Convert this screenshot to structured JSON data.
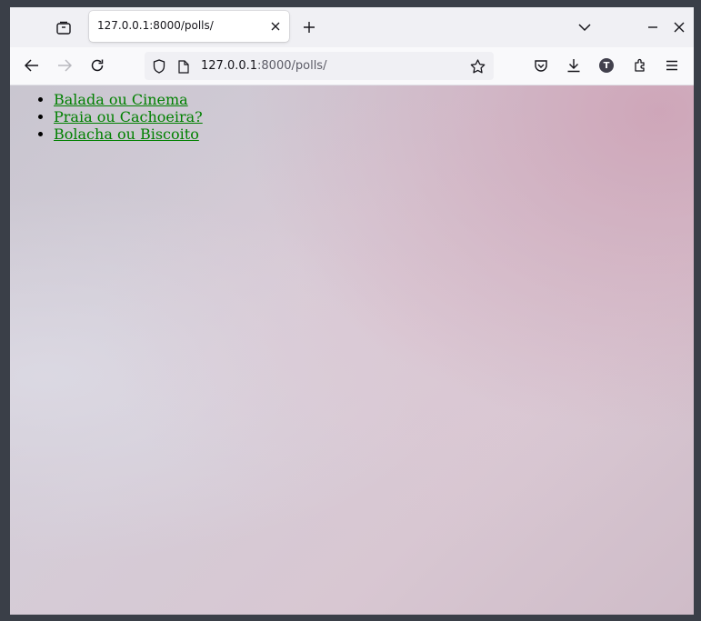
{
  "browser": {
    "tab": {
      "title": "127.0.0.1:8000/polls/"
    },
    "url": {
      "host": "127.0.0.1",
      "rest": ":8000/polls/"
    },
    "account_initial": "T"
  },
  "page": {
    "polls": [
      {
        "label": "Balada ou Cinema"
      },
      {
        "label": "Praia ou Cachoeira?"
      },
      {
        "label": "Bolacha ou Biscoito"
      }
    ]
  },
  "colors": {
    "link": "#008000",
    "chrome": "#f0f0f4",
    "toolbar": "#f9f9fb"
  },
  "icons": [
    "tab-overview-icon",
    "close-icon",
    "plus-icon",
    "chevron-down-icon",
    "minimize-icon",
    "window-close-icon",
    "back-arrow-icon",
    "forward-arrow-icon",
    "reload-icon",
    "shield-icon",
    "page-icon",
    "star-icon",
    "pocket-icon",
    "download-icon",
    "extensions-icon",
    "menu-icon"
  ]
}
